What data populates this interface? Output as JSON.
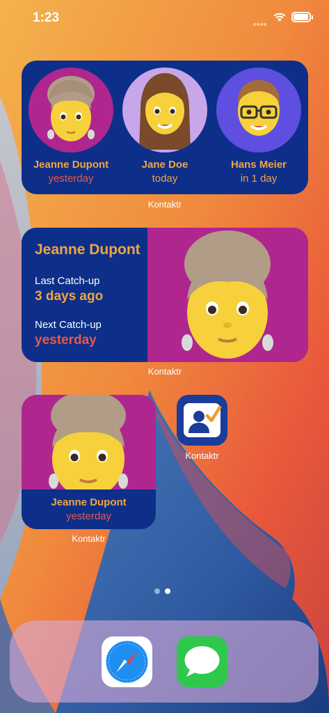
{
  "status_bar": {
    "time": "1:23"
  },
  "widget_contacts": {
    "contacts": [
      {
        "name": "Jeanne Dupont",
        "when": "yesterday"
      },
      {
        "name": "Jane Doe",
        "when": "today"
      },
      {
        "name": "Hans Meier",
        "when": "in 1 day"
      }
    ],
    "app_label": "Kontaktr"
  },
  "widget_catchup": {
    "name": "Jeanne Dupont",
    "last_label": "Last Catch-up",
    "last_value": "3 days ago",
    "next_label": "Next Catch-up",
    "next_value": "yesterday",
    "app_label": "Kontaktr"
  },
  "widget_small": {
    "name": "Jeanne Dupont",
    "when": "yesterday",
    "app_label": "Kontaktr"
  },
  "app_icon": {
    "label": "Kontaktr",
    "icon": "contact-check-icon"
  },
  "page_dots": {
    "count": 2,
    "active": 1
  },
  "dock": {
    "apps": [
      {
        "icon": "safari-icon"
      },
      {
        "icon": "messages-icon"
      }
    ]
  },
  "colors": {
    "widget_blue": "#0d2f8a",
    "magenta": "#b0268f",
    "lavender": "#c7a7e9",
    "violet": "#5e4fe0",
    "accent_orange": "#f2a441",
    "past_red": "#e45a4c"
  }
}
